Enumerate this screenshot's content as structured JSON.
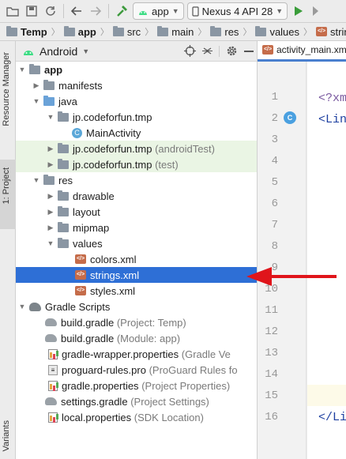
{
  "toolbar": {
    "run_config": "app",
    "device": "Nexus 4 API 28"
  },
  "breadcrumb": [
    "Temp",
    "app",
    "src",
    "main",
    "res",
    "values",
    "strings.xml"
  ],
  "side_stripe": {
    "resource_manager": "Resource Manager",
    "project": "1: Project",
    "variants": "Variants"
  },
  "panel": {
    "view_mode": "Android"
  },
  "tree": [
    {
      "label": "app",
      "bold": true
    },
    {
      "label": "manifests"
    },
    {
      "label": "java"
    },
    {
      "label": "jp.codeforfun.tmp"
    },
    {
      "label": "MainActivity"
    },
    {
      "label": "jp.codeforfun.tmp",
      "suffix": "(androidTest)"
    },
    {
      "label": "jp.codeforfun.tmp",
      "suffix": "(test)"
    },
    {
      "label": "res"
    },
    {
      "label": "drawable"
    },
    {
      "label": "layout"
    },
    {
      "label": "mipmap"
    },
    {
      "label": "values"
    },
    {
      "label": "colors.xml"
    },
    {
      "label": "strings.xml",
      "selected": true
    },
    {
      "label": "styles.xml"
    },
    {
      "label": "Gradle Scripts"
    },
    {
      "label": "build.gradle",
      "suffix": "(Project: Temp)"
    },
    {
      "label": "build.gradle",
      "suffix": "(Module: app)"
    },
    {
      "label": "gradle-wrapper.properties",
      "suffix": "(Gradle Ve"
    },
    {
      "label": "proguard-rules.pro",
      "suffix": "(ProGuard Rules fo"
    },
    {
      "label": "gradle.properties",
      "suffix": "(Project Properties)"
    },
    {
      "label": "settings.gradle",
      "suffix": "(Project Settings)"
    },
    {
      "label": "local.properties",
      "suffix": "(SDK Location)"
    }
  ],
  "editor": {
    "tab": "activity_main.xm",
    "line_numbers": [
      "1",
      "2",
      "3",
      "4",
      "5",
      "6",
      "7",
      "8",
      "9",
      "10",
      "11",
      "12",
      "13",
      "14",
      "15",
      "16"
    ],
    "code_line1": "<?xm",
    "code_line2": "<Lin",
    "code_line16": "</Li",
    "class_badge": "C"
  },
  "colors": {
    "selection": "#2e6fd6",
    "test_source_bg": "#eaf5e4",
    "annotation_arrow": "#e0151b"
  }
}
